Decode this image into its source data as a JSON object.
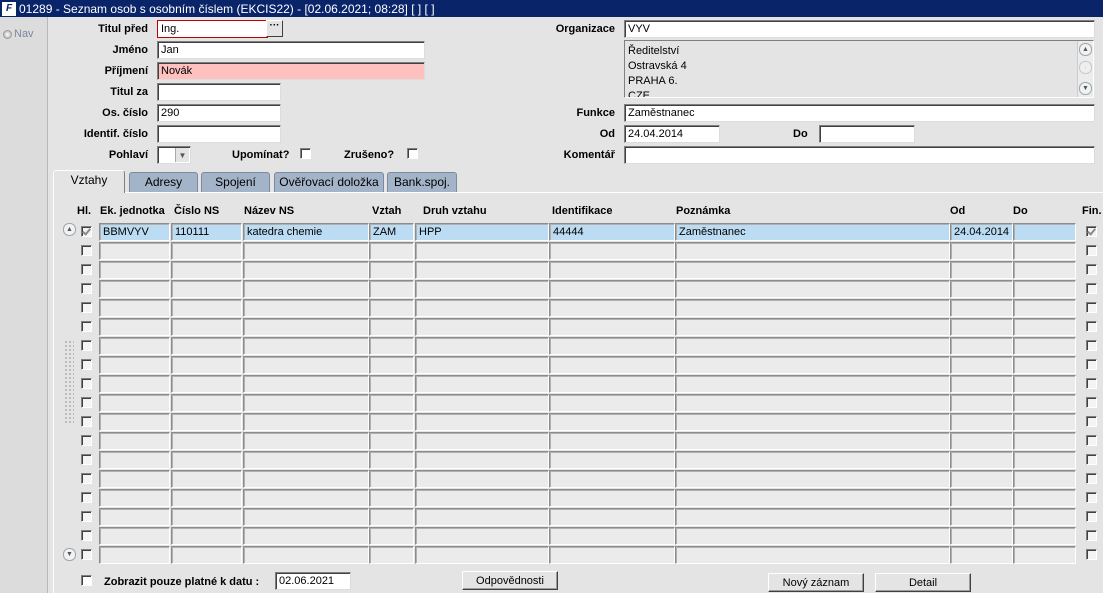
{
  "window": {
    "title": "01289 - Seznam osob s osobním číslem (EKCIS22) - [02.06.2021; 08:28]  [ ] [ ]",
    "icon_text": "F"
  },
  "nav": {
    "label": "Nav"
  },
  "form": {
    "titul_pred": {
      "label": "Titul před",
      "value": "Ing."
    },
    "jmeno": {
      "label": "Jméno",
      "value": "Jan"
    },
    "prijmeni": {
      "label": "Příjmení",
      "value": "Novák"
    },
    "titul_za": {
      "label": "Titul za",
      "value": ""
    },
    "os_cislo": {
      "label": "Os. číslo",
      "value": "290"
    },
    "identif_cislo": {
      "label": "Identif. číslo",
      "value": ""
    },
    "pohlavi": {
      "label": "Pohlaví",
      "value": ""
    },
    "upominat": {
      "label": "Upomínat?",
      "checked": false
    },
    "zruseno": {
      "label": "Zrušeno?",
      "checked": false
    },
    "organizace": {
      "label": "Organizace",
      "value": "VYV"
    },
    "adresa": {
      "line1": "Ředitelství",
      "line2": "Ostravská 4",
      "line3": "PRAHA 6.",
      "line4": "CZE"
    },
    "funkce": {
      "label": "Funkce",
      "value": "Zaměstnanec"
    },
    "od": {
      "label": "Od",
      "value": "24.04.2014"
    },
    "do": {
      "label": "Do",
      "value": ""
    },
    "komentar": {
      "label": "Komentář",
      "value": ""
    }
  },
  "tabs": [
    {
      "label": "Vztahy",
      "active": true
    },
    {
      "label": "Adresy",
      "active": false
    },
    {
      "label": "Spojení",
      "active": false
    },
    {
      "label": "Ověřovací doložka",
      "active": false
    },
    {
      "label": "Bank.spoj.",
      "active": false
    }
  ],
  "grid": {
    "columns": {
      "hl": "Hl.",
      "ek": "Ek. jednotka",
      "cns": "Číslo NS",
      "nns": "Název NS",
      "vztah": "Vztah",
      "druh": "Druh vztahu",
      "ident": "Identifikace",
      "pozn": "Poznámka",
      "od": "Od",
      "do": "Do",
      "fin": "Fin."
    },
    "rows": [
      {
        "hl": true,
        "ek": "BBMVYV",
        "cns": "110111",
        "nns": "katedra chemie",
        "vztah": "ZAM",
        "druh": "HPP",
        "ident": "44444",
        "pozn": "Zaměstnanec",
        "od": "24.04.2014",
        "do": "",
        "fin": true
      }
    ],
    "row_count": 18
  },
  "footer": {
    "filter_label": "Zobrazit pouze platné k datu :",
    "filter_checked": false,
    "filter_date": "02.06.2021",
    "btn_odpovednosti": "Odpovědnosti",
    "btn_novy": "Nový záznam",
    "btn_detail": "Detail"
  }
}
